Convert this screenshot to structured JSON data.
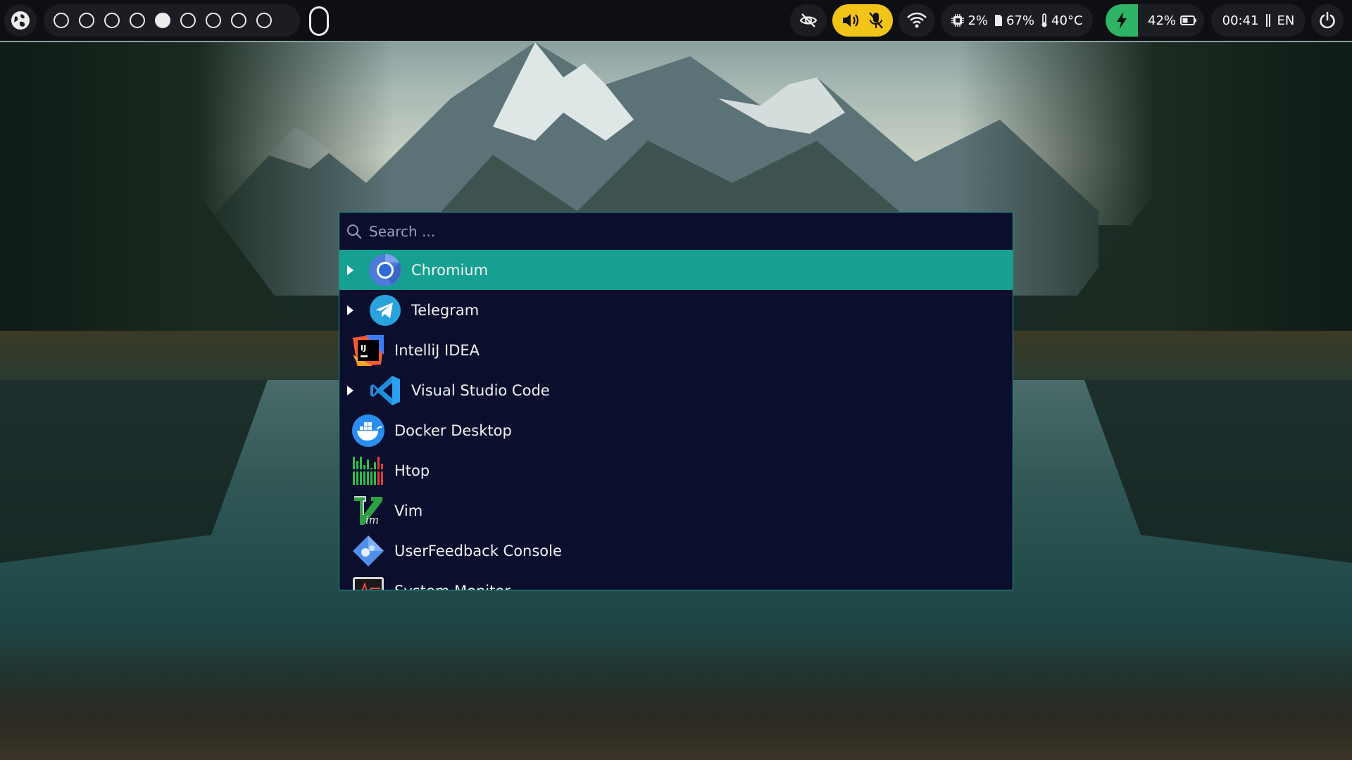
{
  "topbar": {
    "workspaces": [
      {
        "active": false
      },
      {
        "active": false
      },
      {
        "active": false
      },
      {
        "active": false
      },
      {
        "active": true
      },
      {
        "active": false
      },
      {
        "active": false
      },
      {
        "active": false
      },
      {
        "active": false
      }
    ],
    "system": {
      "cpu": "2%",
      "memory": "67%",
      "temperature": "40°C"
    },
    "battery": "42%",
    "clock": "00:41",
    "language": "EN",
    "colors": {
      "bar": "#0e0f12",
      "pill": "#1c1d22",
      "audio": "#f2c318",
      "charge": "#2fb365"
    }
  },
  "launcher": {
    "search_placeholder": "Search ...",
    "accent": "#16a091",
    "background": "#0b0f2d",
    "items": [
      {
        "label": "Chromium",
        "icon": "chromium-icon",
        "expandable": true,
        "selected": true
      },
      {
        "label": "Telegram",
        "icon": "telegram-icon",
        "expandable": true,
        "selected": false
      },
      {
        "label": "IntelliJ IDEA",
        "icon": "intellij-icon",
        "expandable": false,
        "selected": false
      },
      {
        "label": "Visual Studio Code",
        "icon": "vscode-icon",
        "expandable": true,
        "selected": false
      },
      {
        "label": "Docker Desktop",
        "icon": "docker-icon",
        "expandable": false,
        "selected": false
      },
      {
        "label": "Htop",
        "icon": "htop-icon",
        "expandable": false,
        "selected": false
      },
      {
        "label": "Vim",
        "icon": "vim-icon",
        "expandable": false,
        "selected": false
      },
      {
        "label": "UserFeedback Console",
        "icon": "userfeedback-icon",
        "expandable": false,
        "selected": false
      },
      {
        "label": "System Monitor",
        "icon": "system-monitor-icon",
        "expandable": false,
        "selected": false
      }
    ]
  }
}
